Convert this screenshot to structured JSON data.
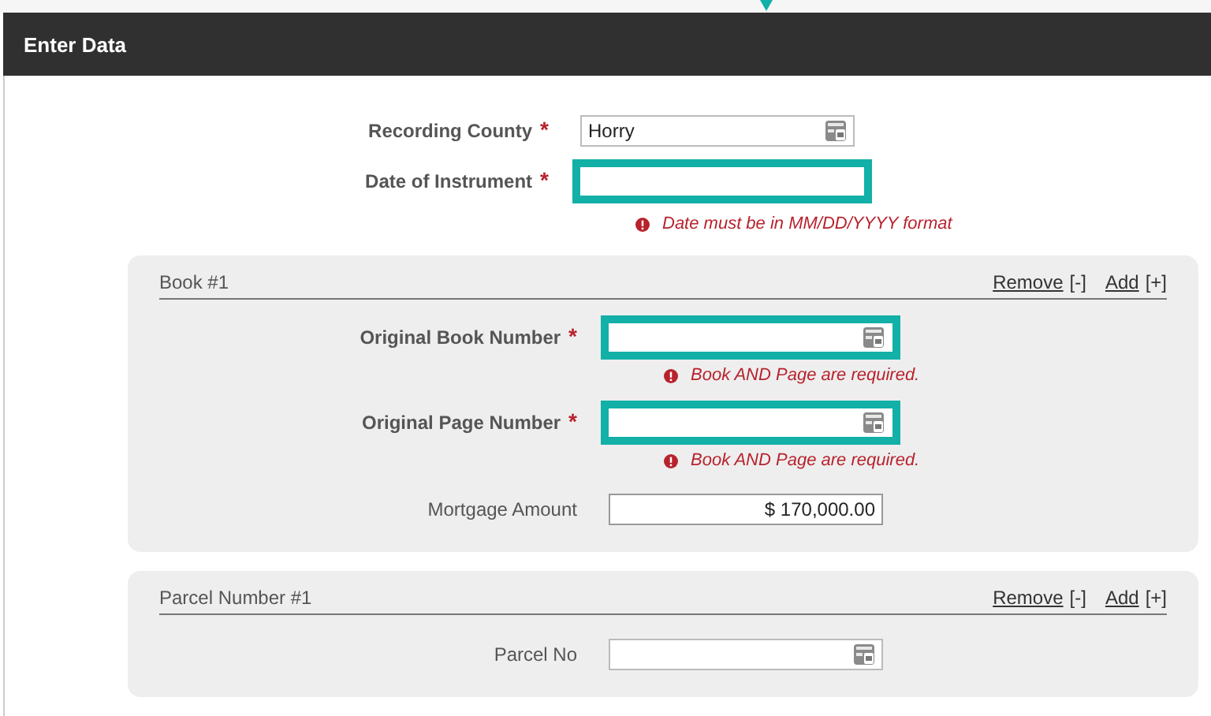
{
  "header": {
    "title": "Enter Data"
  },
  "fields": [
    {
      "label": "Recording County",
      "required_mark": "*",
      "kind": "text",
      "value": "Horry",
      "highlighted": false,
      "lookup": true
    },
    {
      "label": "Date of Instrument",
      "required_mark": "*",
      "kind": "text",
      "highlighted": true,
      "lookup": false,
      "error": "Date must be in MM/DD/YYYY format"
    }
  ],
  "sections": [
    {
      "title": "Book #1",
      "remove_link": "Remove",
      "remove_mark": "[-]",
      "add_link": "Add",
      "add_mark": "[+]",
      "fields": [
        {
          "label": "Original Book Number",
          "required_mark": "*",
          "kind": "text",
          "highlighted": true,
          "lookup": true,
          "error": "Book AND Page are required."
        },
        {
          "label": "Original Page Number",
          "required_mark": "*",
          "kind": "text",
          "highlighted": true,
          "lookup": true,
          "error": "Book AND Page are required."
        },
        {
          "label": "Mortgage Amount",
          "kind": "amount",
          "value": "$ 170,000.00",
          "highlighted": false,
          "lookup": false
        }
      ]
    },
    {
      "title": "Parcel Number #1",
      "remove_link": "Remove",
      "remove_mark": "[-]",
      "add_link": "Add",
      "add_mark": "[+]",
      "fields": [
        {
          "label": "Parcel No",
          "kind": "text",
          "highlighted": false,
          "lookup": true
        }
      ]
    }
  ]
}
